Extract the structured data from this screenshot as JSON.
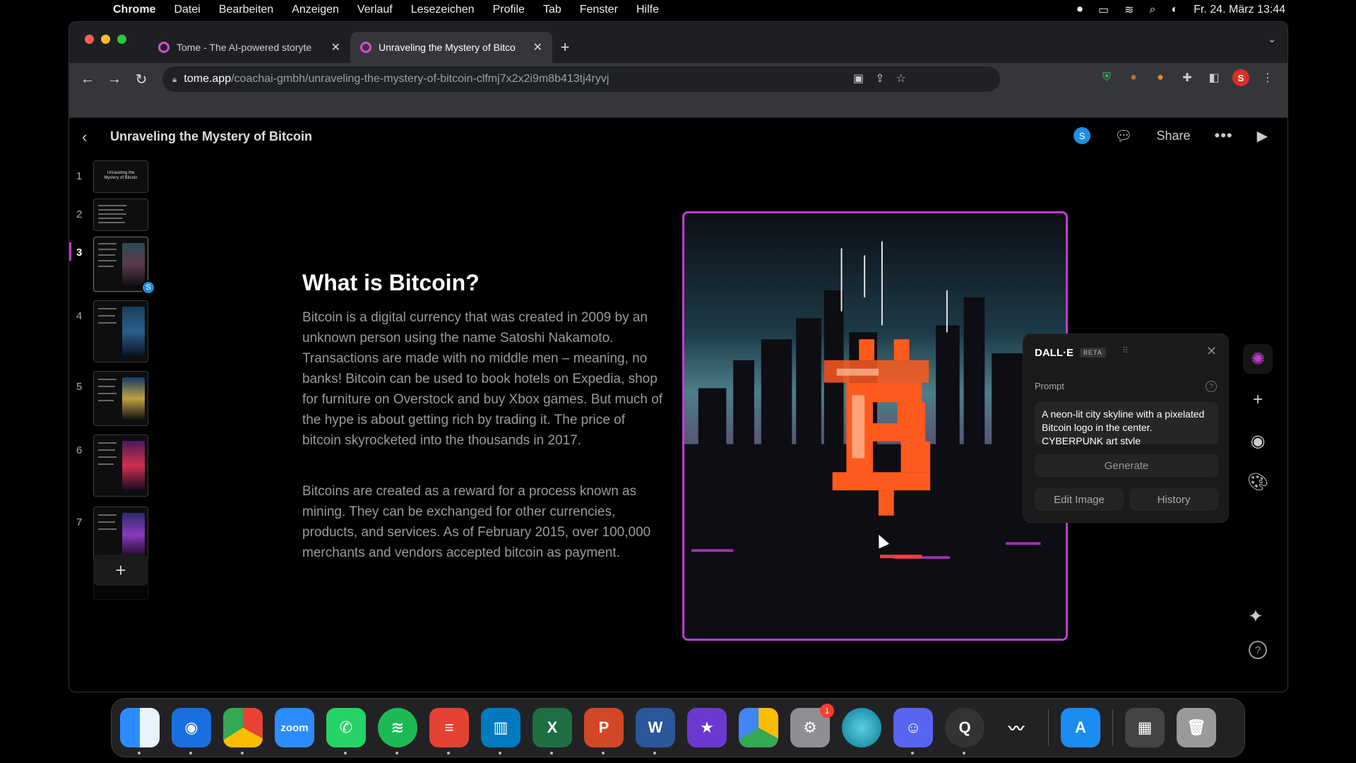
{
  "menubar": {
    "app": "Chrome",
    "items": [
      "Datei",
      "Bearbeiten",
      "Anzeigen",
      "Verlauf",
      "Lesezeichen",
      "Profile",
      "Tab",
      "Fenster",
      "Hilfe"
    ],
    "datetime": "Fr. 24. März 13:44"
  },
  "browser": {
    "tabs": [
      {
        "label": "Tome - The AI-powered storyte"
      },
      {
        "label": "Unraveling the Mystery of Bitco"
      }
    ],
    "url_host": "tome.app",
    "url_path": "/coachai-gmbh/unraveling-the-mystery-of-bitcoin-clfmj7x2x2i9m8b413tj4ryvj",
    "profile_initial": "S"
  },
  "app": {
    "title": "Unraveling the Mystery of Bitcoin",
    "user_initial": "S",
    "share_label": "Share"
  },
  "thumbnails": {
    "numbers": [
      "1",
      "2",
      "3",
      "4",
      "5",
      "6",
      "7"
    ],
    "active": 3,
    "slide1_title": "Unraveling the Mystery of Bitcoin",
    "badge": "S"
  },
  "slide": {
    "heading": "What is Bitcoin?",
    "paragraph1": "Bitcoin is a digital currency that was created in 2009 by an unknown person using the name Satoshi Nakamoto. Transactions are made with no middle men – meaning, no banks! Bitcoin can be used to book hotels on Expedia, shop for furniture on Overstock and buy Xbox games. But much of the hype is about getting rich by trading it. The price of bitcoin skyrocketed into the thousands in 2017.",
    "paragraph2": "Bitcoins are created as a reward for a process known as mining. They can be exchanged for other currencies, products, and services. As of February 2015, over 100,000 merchants and vendors accepted bitcoin as payment."
  },
  "dalle": {
    "title": "DALL·E",
    "badge": "BETA",
    "prompt_label": "Prompt",
    "prompt_text": "A neon-lit city skyline with a pixelated Bitcoin logo in the center. CYBERPUNK art style",
    "generate_label": "Generate",
    "edit_label": "Edit Image",
    "history_label": "History"
  },
  "dock": {
    "apps": [
      "Finder",
      "Safari",
      "Chrome",
      "Zoom",
      "WhatsApp",
      "Spotify",
      "Todoist",
      "Trello",
      "Excel",
      "PowerPoint",
      "Word",
      "iMovie",
      "Google Drive",
      "System Settings",
      "Mirror",
      "Discord",
      "QuickTime",
      "Audio",
      "App Store",
      "Screenshot",
      "Trash"
    ],
    "zoom_label": "zoom",
    "settings_badge": "1"
  },
  "colors": {
    "accent": "#c43ad0",
    "user_blue": "#1f8fe0"
  }
}
